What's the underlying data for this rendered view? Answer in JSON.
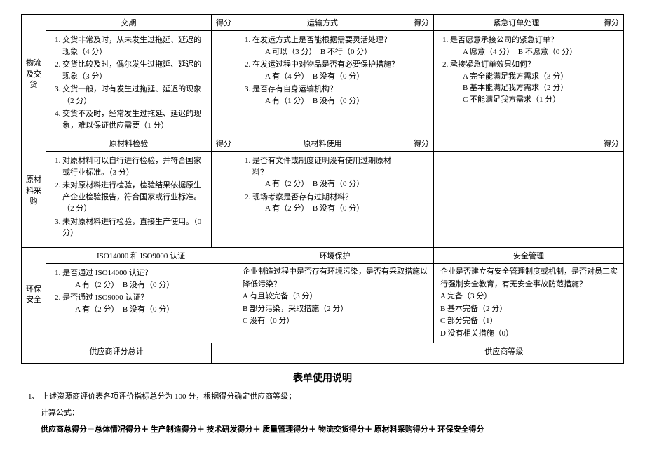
{
  "section1": {
    "side": "物流\n及交\n货",
    "h1": "交期",
    "h1s": "得分",
    "h2": "运输方式",
    "h2s": "得分",
    "h3": "紧急订单处理",
    "h3s": "得分",
    "c1_li1": "交货非常及时，从未发生过拖延、延迟的现象（4 分）",
    "c1_li2": "交货比较及时，偶尔发生过拖延、延迟的现象（3 分）",
    "c1_li3": "交货一般，时有发生过拖延、延迟的现象（2 分）",
    "c1_li4": "交货不及时，经常发生过拖延、延迟的现象，难以保证供应需要（1 分）",
    "c2_li1": "在发运方式上是否能根据需要灵活处理？",
    "c2_li1a": "A 可以（3 分）　B 不行（0 分）",
    "c2_li2": "在发运过程中对物品是否有必要保护措施？",
    "c2_li2a": "A 有（4 分）　B 没有（0 分）",
    "c2_li3": "是否存有自身运输机构？",
    "c2_li3a": "A 有（1 分）　B 没有（0 分）",
    "c3_li1": "是否愿意承接公司的紧急订单？",
    "c3_li1a": "A 愿意（4 分）　B 不愿意（0 分）",
    "c3_li2": "承接紧急订单效果如何？",
    "c3_li2a": "A 完全能满足我方需求（3 分）",
    "c3_li2b": "B 基本能满足我方需求（2 分）",
    "c3_li2c": "C 不能满足我方需求（1 分）"
  },
  "section2": {
    "side": "原材\n料采\n购",
    "h1": "原材料检验",
    "h1s": "得分",
    "h2": "原材料使用",
    "h2s": "得分",
    "h3": "",
    "h3s": "得分",
    "c1_li1": "对原材料可以自行进行检验，并符合国家或行业标准。（3 分）",
    "c1_li2": "未对原材料进行检验，检验结果依据原生产企业检验报告，符合国家或行业标准。（2 分）",
    "c1_li3": "未对原材料进行检验，直接生产使用。（0 分）",
    "c2_li1": "是否有文件或制度证明没有使用过期原材料？",
    "c2_li1a": "A 有（2 分）　B 没有（0 分）",
    "c2_li2": "现场考察是否存有过期材料？",
    "c2_li2a": "A 有（2 分）　B 没有（0 分）"
  },
  "section3": {
    "side": "环保\n安全",
    "h1": "ISO14000 和 ISO9000 认证",
    "h2": "环境保护",
    "h3": "安全管理",
    "c1_li1": "是否通过 ISO14000 认证？",
    "c1_li1a": "A 有（2 分）　B 没有（0 分）",
    "c1_li2": "是否通过 ISO9000 认证？",
    "c1_li2a": "A 有（2 分）　B 没有（0 分）",
    "c2_body": "企业制造过程中是否存有环境污染，是否有采取措施以降低污染？",
    "c2_a": "A 有且较完备（3 分）",
    "c2_b": "B 部分污染，采取措施（2 分）",
    "c2_c": "C 没有（0 分）",
    "c3_body": "企业是否建立有安全管理制度或机制，是否对员工实行强制安全教育，有无安全事故防范措施？",
    "c3_a": "A 完备（3 分）",
    "c3_b": "B 基本完备（2 分）",
    "c3_c": "C 部分完备（1）",
    "c3_d": "D 没有相关措施（0）"
  },
  "footer": {
    "total": "供应商评分总计",
    "grade": "供应商等级"
  },
  "instructions": {
    "title": "表单使用说明",
    "line1": "1、 上述资源商评价表各项评价指标总分为 100 分，根据得分确定供应商等级；",
    "line2": "计算公式：",
    "line3": "供应商总得分＝总体情况得分＋ 生产制造得分＋ 技术研发得分＋ 质量管理得分＋ 物流交货得分＋ 原材料采购得分＋ 环保安全得分"
  }
}
